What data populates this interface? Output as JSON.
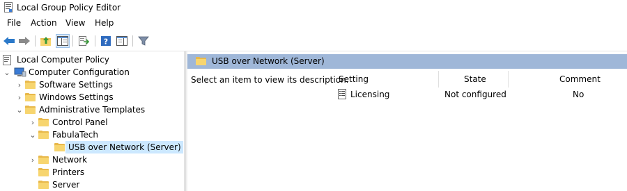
{
  "window": {
    "title": "Local Group Policy Editor"
  },
  "menu": [
    "File",
    "Action",
    "View",
    "Help"
  ],
  "toolbar": {
    "buttons": [
      "back-icon",
      "forward-icon",
      "up-folder-icon",
      "show-hide-tree-icon",
      "export-list-icon",
      "help-icon",
      "properties-icon",
      "filter-icon"
    ]
  },
  "tree": {
    "items": [
      {
        "label": "Local Computer Policy"
      },
      {
        "label": "Computer Configuration"
      },
      {
        "label": "Software Settings"
      },
      {
        "label": "Windows Settings"
      },
      {
        "label": "Administrative Templates"
      },
      {
        "label": "Control Panel"
      },
      {
        "label": "FabulaTech"
      },
      {
        "label": "USB over Network (Server)"
      },
      {
        "label": "Network"
      },
      {
        "label": "Printers"
      },
      {
        "label": "Server"
      }
    ]
  },
  "details": {
    "header": "USB over Network (Server)",
    "description": "Select an item to view its description.",
    "columns": {
      "setting": "Setting",
      "state": "State",
      "comment": "Comment"
    },
    "rows": [
      {
        "setting": "Licensing",
        "state": "Not configured",
        "comment": "No"
      }
    ]
  },
  "colors": {
    "header_band": "#9fb7d8",
    "selection": "#cce8ff",
    "folder": "#f7d56f"
  }
}
